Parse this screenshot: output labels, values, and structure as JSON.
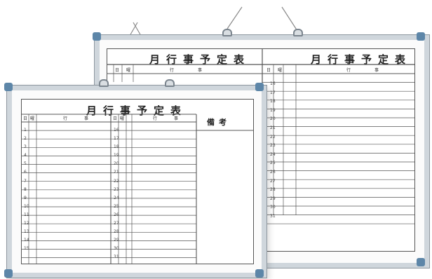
{
  "back_board": {
    "title_left": "月行事予定表",
    "title_right": "月行事予定表",
    "col_headers": [
      "日",
      "曜",
      "行",
      "事"
    ],
    "right_days": [
      "16",
      "17",
      "18",
      "19",
      "20",
      "21",
      "22",
      "23",
      "24",
      "25",
      "26",
      "27",
      "28",
      "29",
      "30",
      "31"
    ]
  },
  "front_board": {
    "title": "月行事予定表",
    "notes_label": "備考",
    "col_headers": [
      "日",
      "曜",
      "行",
      "事"
    ],
    "left_days": [
      "1",
      "2",
      "3",
      "4",
      "5",
      "6",
      "7",
      "8",
      "9",
      "10",
      "11",
      "12",
      "13",
      "14",
      "15"
    ],
    "mid_days": [
      "16",
      "17",
      "18",
      "19",
      "20",
      "21",
      "22",
      "23",
      "24",
      "25",
      "26",
      "27",
      "28",
      "29",
      "30",
      "31"
    ]
  },
  "colors": {
    "frame": "#cfd6dc",
    "corner_caps": "#5d86a8",
    "grid_lines": "#555555"
  }
}
